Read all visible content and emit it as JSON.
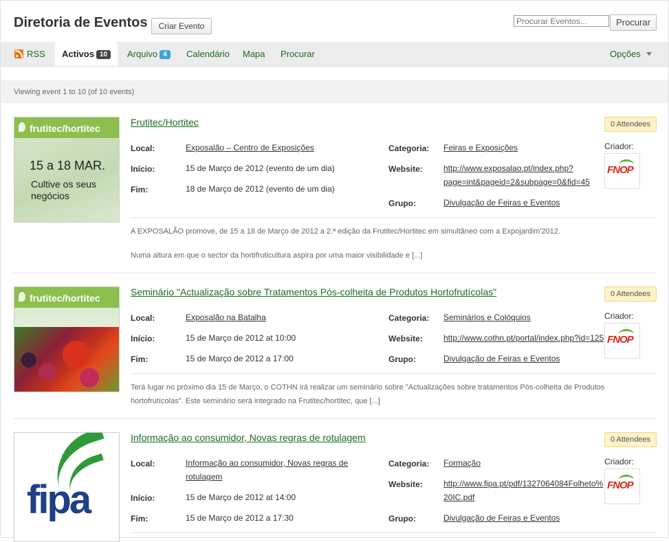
{
  "header": {
    "title": "Diretoria de Eventos",
    "create_button": "Criar Evento",
    "search_placeholder": "Procurar Eventos...",
    "search_button": "Procurar"
  },
  "tabs": {
    "rss": "RSS",
    "active": "Activos",
    "active_count": "10",
    "archive": "Arquivo",
    "archive_count": "4",
    "calendar": "Calendário",
    "map": "Mapa",
    "search": "Procurar",
    "options": "Opções"
  },
  "status": "Viewing event 1 to 10 (of 10 events)",
  "labels": {
    "local": "Local:",
    "inicio": "Início:",
    "fim": "Fim:",
    "categoria": "Categoria:",
    "website": "Website:",
    "grupo": "Grupo:",
    "criador": "Criador:"
  },
  "events": [
    {
      "title": "Frutitec/Hortitec",
      "attendees": "0 Attendees",
      "local": "Exposalão – Centro de Exposições",
      "inicio": "15 de Março de 2012 (evento de um dia)",
      "fim": "18 de Março de 2012 (evento de um dia)",
      "categoria": "Feiras e Exposições",
      "website_line1": "http://www.exposalao.pt/index.php?",
      "website_line2": "page=int&pageid=2&subpage=0&fid=45",
      "grupo": "Divulgação de Feiras e Eventos",
      "desc_line1": "A EXPOSALÃO promove, de 15 a 18 de Março de 2012 a 2.ª edição da Frutitec/Hortitec em simultâneo com a Expojardim'2012.",
      "desc_line2": "Numa altura em que o sector da hortifruticultura aspira por uma maior visibilidade e [...]",
      "thumb_brand": "frutitec/hortitec",
      "thumb_dates": "15 a 18 MAR.",
      "thumb_slogan1": "Cultive os seus",
      "thumb_slogan2": "negócios"
    },
    {
      "title": "Seminário \"Actualização sobre Tratamentos Pós-colheita de Produtos Hortofrutícolas\"",
      "attendees": "0 Attendees",
      "local": "Exposalão na Batalha",
      "inicio": "15 de Março de 2012 at 10:00",
      "fim": "15 de Março de 2012 a 17:00",
      "categoria": "Seminários e Colóquios",
      "website_line1": "http://www.cothn.pt/portal/index.php?id=125",
      "grupo": "Divulgação de Feiras e Eventos",
      "desc_line1": "Terá lugar no próximo dia 15 de Março, o COTHN irá realizar um seminário sobre \"Actualizações sobre tratamentos Pós-colheita de Produtos",
      "desc_line2": "hortofrutícolas\". Este seminário será integrado na Frutitec/hortitec, que [...]",
      "thumb_brand": "frutitec/hortitec"
    },
    {
      "title": "Informação ao consumidor, Novas regras de rotulagem",
      "attendees": "0 Attendees",
      "local_line1": "Informação ao consumidor, Novas regras de",
      "local_line2": "rotulagem",
      "inicio": "15 de Março de 2012 at 14:00",
      "fim": "15 de Março de 2012 a 17:30",
      "categoria": "Formação",
      "website_line1": "http://www.fipa.pt/pdf/1327064084Folheto%",
      "website_line2": "20IC.pdf",
      "grupo": "Divulgação de Feiras e Eventos",
      "thumb_brand": "fipa"
    }
  ],
  "creator_logo_text": "FNOP"
}
